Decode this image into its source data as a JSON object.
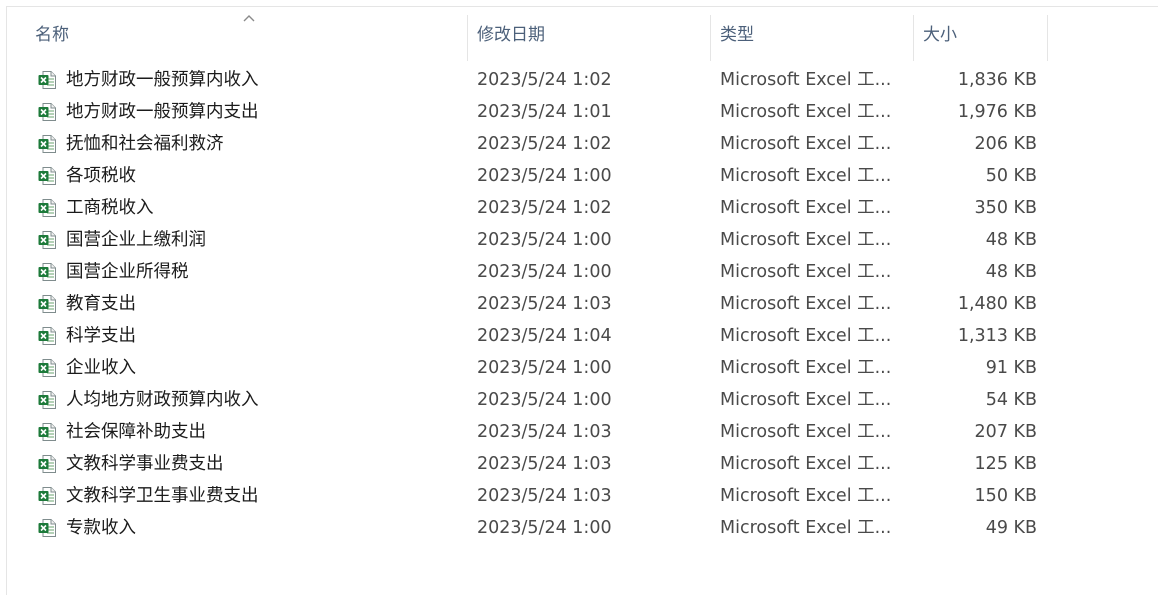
{
  "columns": {
    "name": "名称",
    "date": "修改日期",
    "type": "类型",
    "size": "大小"
  },
  "files": [
    {
      "name": "地方财政一般预算内收入",
      "date": "2023/5/24 1:02",
      "type": "Microsoft Excel 工...",
      "size": "1,836 KB"
    },
    {
      "name": "地方财政一般预算内支出",
      "date": "2023/5/24 1:01",
      "type": "Microsoft Excel 工...",
      "size": "1,976 KB"
    },
    {
      "name": "抚恤和社会福利救济",
      "date": "2023/5/24 1:02",
      "type": "Microsoft Excel 工...",
      "size": "206 KB"
    },
    {
      "name": "各项税收",
      "date": "2023/5/24 1:00",
      "type": "Microsoft Excel 工...",
      "size": "50 KB"
    },
    {
      "name": "工商税收入",
      "date": "2023/5/24 1:02",
      "type": "Microsoft Excel 工...",
      "size": "350 KB"
    },
    {
      "name": "国营企业上缴利润",
      "date": "2023/5/24 1:00",
      "type": "Microsoft Excel 工...",
      "size": "48 KB"
    },
    {
      "name": "国营企业所得税",
      "date": "2023/5/24 1:00",
      "type": "Microsoft Excel 工...",
      "size": "48 KB"
    },
    {
      "name": "教育支出",
      "date": "2023/5/24 1:03",
      "type": "Microsoft Excel 工...",
      "size": "1,480 KB"
    },
    {
      "name": "科学支出",
      "date": "2023/5/24 1:04",
      "type": "Microsoft Excel 工...",
      "size": "1,313 KB"
    },
    {
      "name": "企业收入",
      "date": "2023/5/24 1:00",
      "type": "Microsoft Excel 工...",
      "size": "91 KB"
    },
    {
      "name": "人均地方财政预算内收入",
      "date": "2023/5/24 1:00",
      "type": "Microsoft Excel 工...",
      "size": "54 KB"
    },
    {
      "name": "社会保障补助支出",
      "date": "2023/5/24 1:03",
      "type": "Microsoft Excel 工...",
      "size": "207 KB"
    },
    {
      "name": "文教科学事业费支出",
      "date": "2023/5/24 1:03",
      "type": "Microsoft Excel 工...",
      "size": "125 KB"
    },
    {
      "name": "文教科学卫生事业费支出",
      "date": "2023/5/24 1:03",
      "type": "Microsoft Excel 工...",
      "size": "150 KB"
    },
    {
      "name": "专款收入",
      "date": "2023/5/24 1:00",
      "type": "Microsoft Excel 工...",
      "size": "49 KB"
    }
  ],
  "icons": {
    "file": "excel-file-icon",
    "sort": "sort-ascending-icon"
  },
  "colors": {
    "header_text": "#4c607a",
    "excel_green": "#1d7a3a",
    "row_text": "#1b1b1b"
  }
}
